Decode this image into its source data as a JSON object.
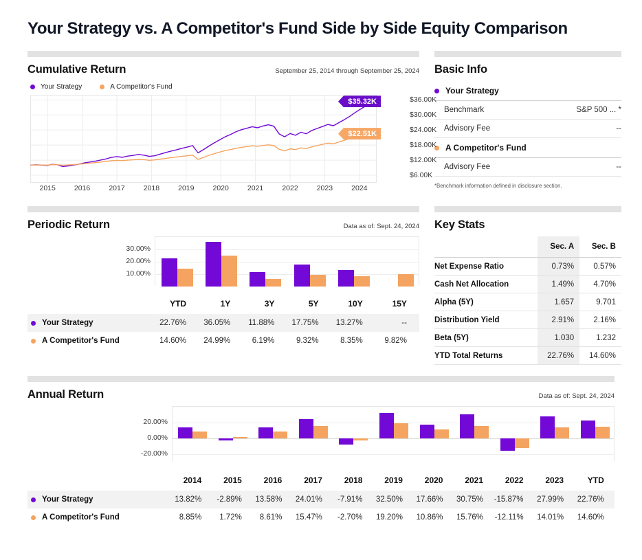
{
  "title": "Your Strategy vs. A Competitor's Fund Side by Side Equity Comparison",
  "series": {
    "a": {
      "name": "Your Strategy",
      "color": "#7209d6"
    },
    "b": {
      "name": "A Competitor's Fund",
      "color": "#f4a460"
    }
  },
  "cumulative": {
    "heading": "Cumulative Return",
    "date_range": "September 25, 2014 through September 25, 2024",
    "callout_a": "$35.32K",
    "callout_b": "$22.51K"
  },
  "periodic": {
    "heading": "Periodic Return",
    "data_as_of": "Data as of: Sept. 24, 2024"
  },
  "annual": {
    "heading": "Annual Return",
    "data_as_of": "Data as of: Sept. 24, 2024"
  },
  "basic_info": {
    "heading": "Basic Info",
    "group_a": "Your Strategy",
    "group_b": "A Competitor's Fund",
    "benchmark_label": "Benchmark",
    "benchmark_value": "S&P 500 ... *",
    "advisory_fee_label": "Advisory Fee",
    "advisory_fee_a": "--",
    "advisory_fee_b": "--",
    "footnote": "*Benchmark information defined in disclosure section."
  },
  "key_stats": {
    "heading": "Key Stats",
    "col_blank": "",
    "col_a": "Sec. A",
    "col_b": "Sec. B",
    "rows": [
      {
        "label": "Net Expense Ratio",
        "a": "0.73%",
        "b": "0.57%"
      },
      {
        "label": "Cash Net Allocation",
        "a": "1.49%",
        "b": "4.70%"
      },
      {
        "label": "Alpha (5Y)",
        "a": "1.657",
        "b": "9.701"
      },
      {
        "label": "Distribution Yield",
        "a": "2.91%",
        "b": "2.16%"
      },
      {
        "label": "Beta (5Y)",
        "a": "1.030",
        "b": "1.232"
      },
      {
        "label": "YTD Total Returns",
        "a": "22.76%",
        "b": "14.60%"
      }
    ]
  },
  "chart_data": [
    {
      "type": "line",
      "title": "Cumulative Return",
      "subtitle": "September 25, 2014 through September 25, 2024",
      "xlabel": "",
      "ylabel": "",
      "ylim": [
        3000,
        38000
      ],
      "yticks": [
        6000,
        12000,
        18000,
        24000,
        30000,
        36000
      ],
      "ytick_labels": [
        "$6.00K",
        "$12.00K",
        "$18.00K",
        "$24.00K",
        "$30.00K",
        "$36.00K"
      ],
      "xticks": [
        2015,
        2016,
        2017,
        2018,
        2019,
        2020,
        2021,
        2022,
        2023,
        2024
      ],
      "xtick_labels": [
        "2015",
        "2016",
        "2017",
        "2018",
        "2019",
        "2020",
        "2021",
        "2022",
        "2023",
        "2024"
      ],
      "grid": true,
      "legend_position": "top-left",
      "end_labels": {
        "Your Strategy": "$35.32K",
        "A Competitor's Fund": "$22.51K"
      },
      "series": [
        {
          "name": "Your Strategy",
          "color": "#7209d6",
          "values": [
            10000,
            10150,
            10050,
            9900,
            10300,
            10180,
            9450,
            9700,
            10050,
            10400,
            10900,
            11250,
            11600,
            12050,
            12500,
            13100,
            13400,
            13150,
            13600,
            13900,
            14250,
            14000,
            13500,
            13750,
            14400,
            15000,
            15600,
            16100,
            16700,
            17200,
            17800,
            14900,
            16200,
            17600,
            18900,
            20100,
            21300,
            22200,
            23300,
            24100,
            24700,
            25300,
            24900,
            25600,
            26100,
            25500,
            22400,
            21300,
            22600,
            21900,
            23100,
            22500,
            23800,
            24600,
            25400,
            26200,
            25700,
            26900,
            28100,
            29400,
            30900,
            32300,
            33600,
            34500,
            35320
          ]
        },
        {
          "name": "A Competitor's Fund",
          "color": "#f4a460",
          "values": [
            10000,
            10100,
            10080,
            10020,
            10200,
            10150,
            9980,
            10100,
            10250,
            10400,
            10600,
            10800,
            11000,
            11250,
            11500,
            11750,
            11900,
            11800,
            12000,
            12150,
            12300,
            12200,
            11950,
            12100,
            12400,
            12700,
            13000,
            13250,
            13500,
            13750,
            14000,
            12300,
            13100,
            13900,
            14600,
            15200,
            15800,
            16200,
            16700,
            17100,
            17400,
            17700,
            17500,
            17850,
            18100,
            17800,
            16300,
            15700,
            16500,
            16200,
            16900,
            16600,
            17300,
            17800,
            18300,
            18800,
            18500,
            19200,
            19900,
            20600,
            21300,
            21800,
            22200,
            22400,
            22510
          ]
        }
      ]
    },
    {
      "type": "bar",
      "title": "Periodic Return",
      "subtitle": "Data as of: Sept. 24, 2024",
      "categories": [
        "YTD",
        "1Y",
        "3Y",
        "5Y",
        "10Y",
        "15Y"
      ],
      "ylim": [
        0,
        40
      ],
      "yticks": [
        10,
        20,
        30
      ],
      "ytick_labels": [
        "10.00%",
        "20.00%",
        "30.00%"
      ],
      "grid": true,
      "series": [
        {
          "name": "Your Strategy",
          "color": "#7209d6",
          "values": [
            22.76,
            36.05,
            11.88,
            17.75,
            13.27,
            null
          ],
          "labels": [
            "22.76%",
            "36.05%",
            "11.88%",
            "17.75%",
            "13.27%",
            "--"
          ]
        },
        {
          "name": "A Competitor's Fund",
          "color": "#f4a460",
          "values": [
            14.6,
            24.99,
            6.19,
            9.32,
            8.35,
            9.82
          ],
          "labels": [
            "14.60%",
            "24.99%",
            "6.19%",
            "9.32%",
            "8.35%",
            "9.82%"
          ]
        }
      ]
    },
    {
      "type": "bar",
      "title": "Annual Return",
      "subtitle": "Data as of: Sept. 24, 2024",
      "categories": [
        "2014",
        "2015",
        "2016",
        "2017",
        "2018",
        "2019",
        "2020",
        "2021",
        "2022",
        "2023",
        "YTD"
      ],
      "ylim": [
        -30,
        40
      ],
      "yticks": [
        -20,
        0,
        20
      ],
      "ytick_labels": [
        "-20.00%",
        "0.00%",
        "20.00%"
      ],
      "grid": true,
      "series": [
        {
          "name": "Your Strategy",
          "color": "#7209d6",
          "values": [
            13.82,
            -2.89,
            13.58,
            24.01,
            -7.91,
            32.5,
            17.66,
            30.75,
            -15.87,
            27.99,
            22.76
          ],
          "labels": [
            "13.82%",
            "-2.89%",
            "13.58%",
            "24.01%",
            "-7.91%",
            "32.50%",
            "17.66%",
            "30.75%",
            "-15.87%",
            "27.99%",
            "22.76%"
          ]
        },
        {
          "name": "A Competitor's Fund",
          "color": "#f4a460",
          "values": [
            8.85,
            1.72,
            8.61,
            15.47,
            -2.7,
            19.2,
            10.86,
            15.76,
            -12.11,
            14.01,
            14.6
          ],
          "labels": [
            "8.85%",
            "1.72%",
            "8.61%",
            "15.47%",
            "-2.70%",
            "19.20%",
            "10.86%",
            "15.76%",
            "-12.11%",
            "14.01%",
            "14.60%"
          ]
        }
      ]
    }
  ]
}
